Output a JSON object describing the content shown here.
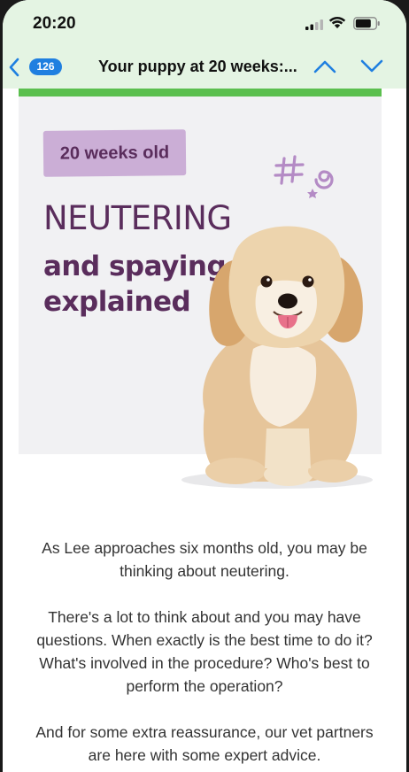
{
  "status_bar": {
    "time": "20:20"
  },
  "nav": {
    "unread_count": "126",
    "title": "Your puppy at 20 weeks:..."
  },
  "hero": {
    "tag": "20 weeks old",
    "heading": "NEUTERING",
    "subheading": "and spaying explained"
  },
  "body": {
    "paragraph1": "As Lee approaches six months old, you may be thinking about neutering.",
    "paragraph2": "There's a lot to think about and you may have questions. When exactly is the best time to do it? What's involved in the procedure? Who's best to perform the operation?",
    "paragraph3": "And for some extra reassurance, our vet partners are here with some expert advice."
  },
  "colors": {
    "header_bg": "#e4f4e3",
    "accent_blue": "#1f7fe0",
    "green_strip": "#5bbf4e",
    "brand_purple": "#5a2d5c",
    "tag_lilac": "#cbaed6"
  },
  "icons": [
    "signal-icon",
    "wifi-icon",
    "battery-icon",
    "back-chevron-icon",
    "chevron-up-icon",
    "chevron-down-icon",
    "doodle-decoration",
    "puppy-image"
  ]
}
